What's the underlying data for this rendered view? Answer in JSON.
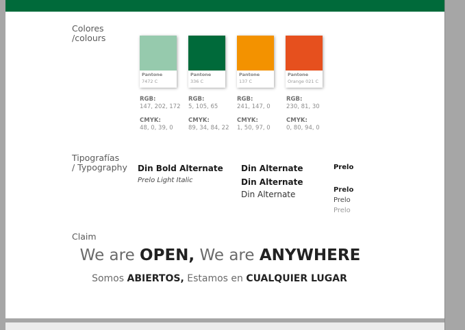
{
  "sections": {
    "colors_label_1": "Colores",
    "colors_label_2": "/colours",
    "typo_label_1": "Tipografías",
    "typo_label_2": "/ Typography",
    "claim_label": "Claim"
  },
  "swatches": [
    {
      "hex": "#96caad",
      "name": "Pantone",
      "code": "7472 C",
      "rgb_label": "RGB:",
      "rgb": "147, 202, 172",
      "cmyk_label": "CMYK:",
      "cmyk": "48, 0, 39, 0"
    },
    {
      "hex": "#006a3a",
      "name": "Pantone",
      "code": "336 C",
      "rgb_label": "RGB:",
      "rgb": "5, 105, 65",
      "cmyk_label": "CMYK:",
      "cmyk": "89, 34, 84, 22"
    },
    {
      "hex": "#f39200",
      "name": "Pantone",
      "code": "137 C",
      "rgb_label": "RGB:",
      "rgb": "241, 147, 0",
      "cmyk_label": "CMYK:",
      "cmyk": "1, 50, 97, 0"
    },
    {
      "hex": "#e6501e",
      "name": "Pantone",
      "code": "Orange 021 C",
      "rgb_label": "RGB:",
      "rgb": "230, 81, 30",
      "cmyk_label": "CMYK:",
      "cmyk": "0, 80, 94, 0"
    }
  ],
  "typography": {
    "din_bold_alt": "Din Bold Alternate",
    "prelo_light_italic": "Prelo Light Italic",
    "din_alt_1": "Din Alternate",
    "din_alt_2": "Din Alternate",
    "din_alt_3": "Din Alternate",
    "prelo_1": "Prelo",
    "prelo_2": "Prelo",
    "prelo_3": "Prelo",
    "prelo_4": "Prelo"
  },
  "claim": {
    "line1_a": "We are ",
    "line1_b": "OPEN,",
    "line1_c": " We are ",
    "line1_d": "ANYWHERE",
    "line2_a": "Somos ",
    "line2_b": "ABIERTOS,",
    "line2_c": " Estamos en ",
    "line2_d": "CUALQUIER LUGAR"
  },
  "colors": {
    "brand_green": "#006a3a",
    "page_bg": "#ffffff",
    "outer_bg": "#a6a6a6"
  }
}
